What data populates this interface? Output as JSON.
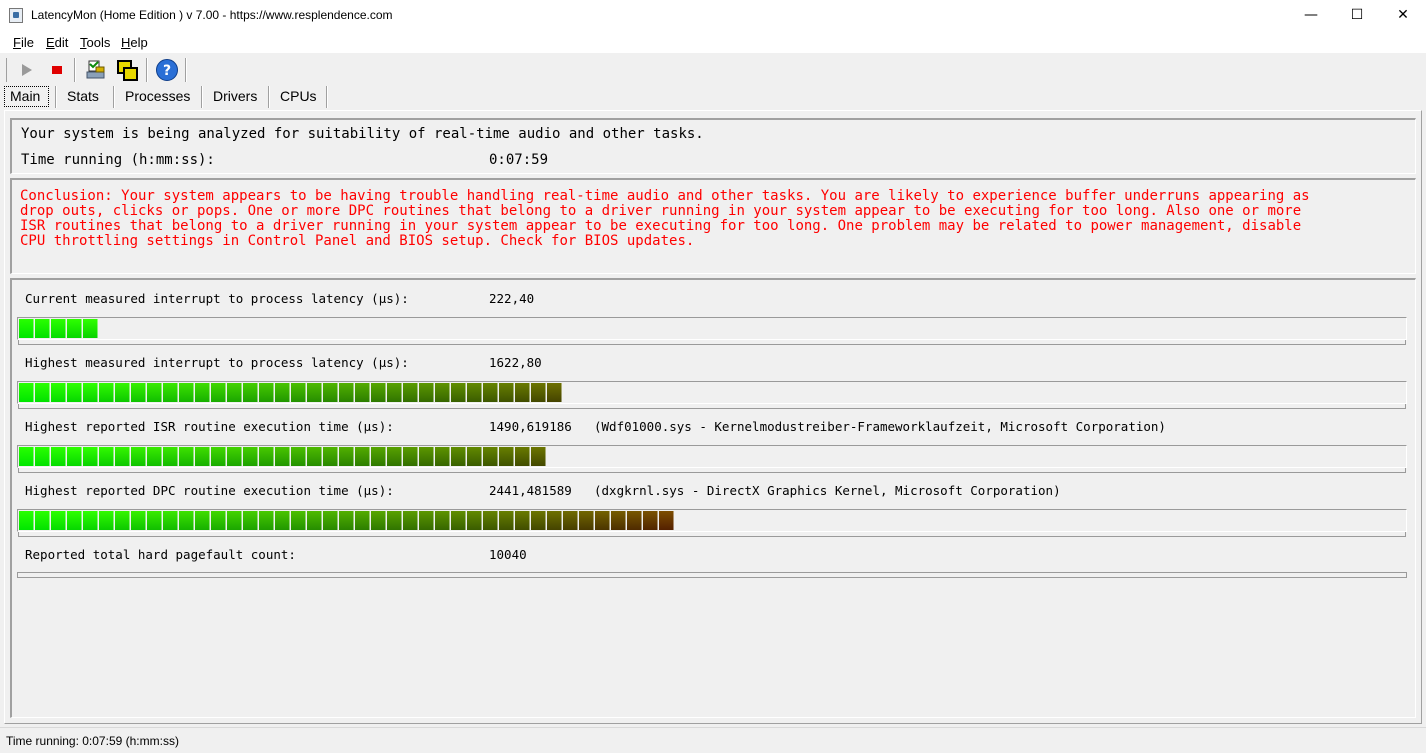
{
  "window": {
    "title": "LatencyMon  (Home Edition )  v 7.00 - https://www.resplendence.com",
    "minimize_glyph": "—",
    "maximize_glyph": "☐",
    "close_glyph": "✕"
  },
  "menu": [
    {
      "label": "File"
    },
    {
      "label": "Edit"
    },
    {
      "label": "Tools"
    },
    {
      "label": "Help"
    }
  ],
  "toolbar": {
    "icons": [
      "play-icon",
      "stop-icon",
      "analyze-icon",
      "windows-icon",
      "help-icon"
    ],
    "stop_color": "#e00000",
    "help_glyph": "?"
  },
  "tabs": [
    {
      "label": "Main",
      "active": true
    },
    {
      "label": "Stats"
    },
    {
      "label": "Processes"
    },
    {
      "label": "Drivers"
    },
    {
      "label": "CPUs"
    }
  ],
  "status_panel": {
    "analyzing_text": "Your system is being analyzed for suitability of real-time audio and other tasks.",
    "time_label": "Time running (h:mm:ss):",
    "time_value": "0:07:59"
  },
  "conclusion": {
    "color": "#ff0000",
    "text": "Conclusion: Your system appears to be having trouble handling real-time audio and other tasks. You are likely to experience buffer underruns appearing as\ndrop outs, clicks or pops. One or more DPC routines that belong to a driver running in your system appear to be executing for too long. Also one or more\nISR routines that belong to a driver running in your system appear to be executing for too long. One problem may be related to power management, disable\nCPU throttling settings in Control Panel and BIOS setup. Check for BIOS updates."
  },
  "metrics": [
    {
      "label": "Current measured interrupt to process latency (µs):",
      "value": "222,40",
      "extra": "",
      "segments": 5
    },
    {
      "label": "Highest measured interrupt to process latency (µs):",
      "value": "1622,80",
      "extra": "",
      "segments": 34
    },
    {
      "label": "Highest reported ISR routine execution time (µs):",
      "value": "1490,619186",
      "extra": "(Wdf01000.sys - Kernelmodustreiber-Frameworklaufzeit, Microsoft Corporation)",
      "segments": 33
    },
    {
      "label": "Highest reported DPC routine execution time (µs):",
      "value": "2441,481589",
      "extra": "(dxgkrnl.sys - DirectX Graphics Kernel, Microsoft Corporation)",
      "segments": 41
    },
    {
      "label": "Reported total hard pagefault count:",
      "value": "10040",
      "extra": "",
      "segments": 0
    }
  ],
  "bar_colors": {
    "start": "#00ff00",
    "end": "#8b3300"
  },
  "statusbar": {
    "text": "Time running: 0:07:59  (h:mm:ss)"
  }
}
